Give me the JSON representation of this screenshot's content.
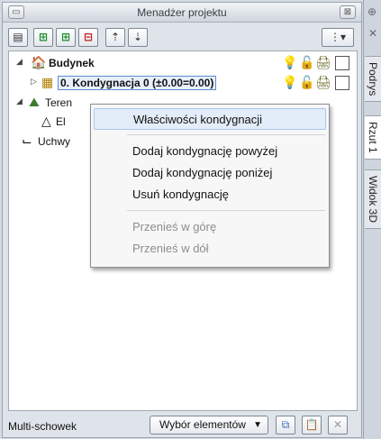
{
  "panel": {
    "title": "Menadżer projektu",
    "close_glyph": "⊠",
    "menu_glyph": "▭"
  },
  "toolbar": {
    "buttons": [
      {
        "name": "properties-button",
        "glyph": "▤"
      },
      {
        "name": "add-above-button",
        "glyph": "⊞"
      },
      {
        "name": "add-below-button",
        "glyph": "⊞"
      },
      {
        "name": "delete-button",
        "glyph": "⊟"
      },
      {
        "name": "move-up-button",
        "glyph": "⇡"
      },
      {
        "name": "move-down-button",
        "glyph": "⇣"
      },
      {
        "name": "options-button",
        "glyph": "⋮▾"
      }
    ]
  },
  "tree": {
    "items": [
      {
        "label": "Budynek",
        "expander": "◢",
        "icon": "🏠",
        "bold": true
      },
      {
        "label": "0. Kondygnacja 0 (±0.00=0.00)",
        "expander": "▷",
        "icon": "▦",
        "bold": true
      },
      {
        "label": "Teren",
        "expander": "◢",
        "icon": "⛰",
        "bold": false
      },
      {
        "label": "El",
        "expander": "",
        "icon": "△",
        "bold": false
      },
      {
        "label": "Uchwy",
        "expander": "",
        "icon": "⌙",
        "bold": false
      }
    ],
    "row_icons": {
      "bulb": "💡",
      "lock": "🔓",
      "print": "🖨"
    }
  },
  "context_menu": {
    "items": [
      {
        "label": "Właściwości kondygnacji",
        "state": "highlighted"
      },
      {
        "label": "Dodaj kondygnację powyżej",
        "state": "normal"
      },
      {
        "label": "Dodaj kondygnację poniżej",
        "state": "normal"
      },
      {
        "label": "Usuń kondygnację",
        "state": "normal"
      },
      {
        "label": "Przenieś w górę",
        "state": "disabled"
      },
      {
        "label": "Przenieś w dół",
        "state": "disabled"
      }
    ]
  },
  "bottom": {
    "multi_label": "Multi-schowek",
    "selection_dropdown": "Wybór elementów",
    "dropdown_arrow": "▼",
    "copy_glyph": "⧉",
    "paste_glyph": "📋",
    "clear_glyph": "✕"
  },
  "side_tabs": {
    "pin_glyph": "⊕",
    "close_glyph": "✕",
    "tabs": [
      "Podrys",
      "Rzut 1",
      "Widok 3D"
    ]
  }
}
